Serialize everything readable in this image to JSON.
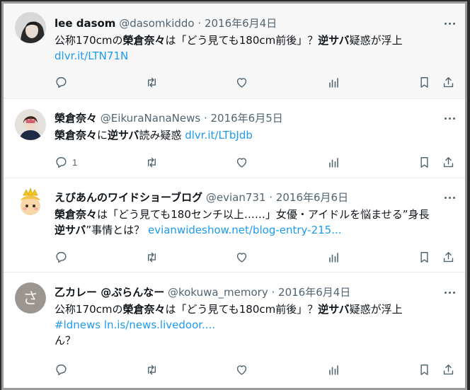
{
  "tweets": [
    {
      "display_name": "lee dasom",
      "handle": "@dasomkiddo",
      "date": "2016年6月4日",
      "body": [
        {
          "t": "公称170cmの",
          "b": false
        },
        {
          "t": "榮倉奈々",
          "b": true
        },
        {
          "t": "は「どう見ても180cm前後」？",
          "b": false
        },
        {
          "t": "逆サバ",
          "b": true
        },
        {
          "t": "疑惑が浮上",
          "b": false
        }
      ],
      "link_line": [
        "dlvr.it/LTN71N"
      ],
      "extra_line": "",
      "reply_count": ""
    },
    {
      "display_name": "榮倉奈々",
      "handle": "@EikuraNanaNews",
      "date": "2016年6月5日",
      "body": [
        {
          "t": "榮倉奈々",
          "b": true
        },
        {
          "t": "に",
          "b": false
        },
        {
          "t": "逆サバ",
          "b": true
        },
        {
          "t": "読み疑惑",
          "b": false
        }
      ],
      "inline_link": "dlvr.it/LTbJdb",
      "link_line": [],
      "extra_line": "",
      "reply_count": "1"
    },
    {
      "display_name": "えびあんのワイドショーブログ",
      "handle": "@evian731",
      "date": "2016年6月6日",
      "body": [
        {
          "t": "榮倉奈々",
          "b": true
        },
        {
          "t": "は「どう見ても180センチ以上……」女優・アイドルを悩ませる”身長",
          "b": false
        }
      ],
      "body2": [
        {
          "t": "逆サバ",
          "b": true
        },
        {
          "t": "”事情とは？",
          "b": false
        }
      ],
      "inline_link2": "evianwideshow.net/blog-entry-215...",
      "link_line": [],
      "extra_line": "",
      "reply_count": ""
    },
    {
      "display_name": "乙カレー @ぷらんなー",
      "handle": "@kokuwa_memory",
      "date": "2016年6月4日",
      "body": [
        {
          "t": "公称170cmの",
          "b": false
        },
        {
          "t": "榮倉奈々",
          "b": true
        },
        {
          "t": "は「どう見ても180cm前後」？",
          "b": false
        },
        {
          "t": "逆サバ",
          "b": true
        },
        {
          "t": "疑惑が浮上",
          "b": false
        }
      ],
      "link_line": [
        "#ldnews",
        "ln.is/news.livedoor...."
      ],
      "extra_line": "ん？",
      "reply_count": ""
    }
  ],
  "separator": " · ",
  "icons": [
    "reply-icon",
    "retweet-icon",
    "like-icon",
    "views-icon",
    "bookmark-icon",
    "share-icon",
    "more-icon"
  ],
  "colors": {
    "link": "#1d9bf0",
    "icon": "#536471",
    "text": "#0f1419"
  }
}
